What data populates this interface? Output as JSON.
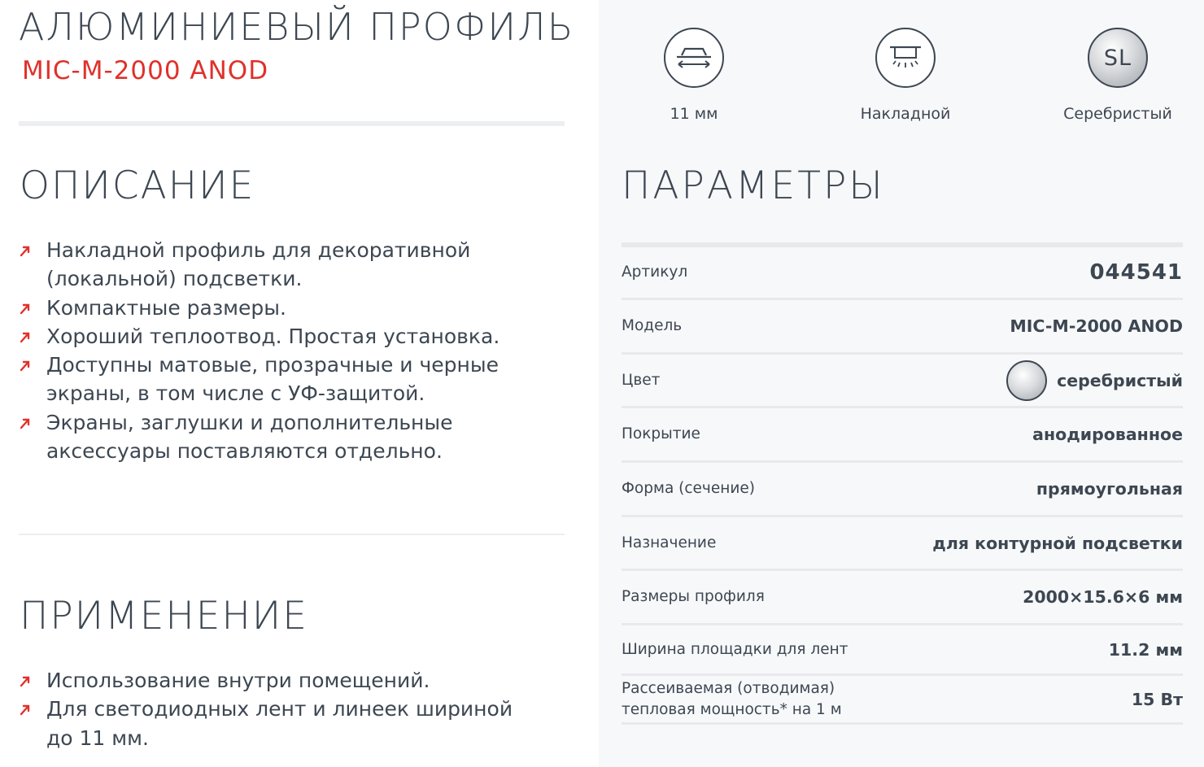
{
  "product": {
    "title": "АЛЮМИНИЕВЫЙ ПРОФИЛЬ",
    "model": "MIC-M-2000 ANOD"
  },
  "description": {
    "heading": "ОПИСАНИЕ",
    "bullets": [
      "Накладной профиль для декоративной (локальной) подсветки.",
      "Компактные размеры.",
      "Хороший теплоотвод. Простая установка.",
      "Доступны матовые, прозрачные и черные экраны, в том числе с УФ-защитой.",
      "Экраны, заглушки и дополнительные аксессуары поставляются отдельно."
    ]
  },
  "application": {
    "heading": "ПРИМЕНЕНИЕ",
    "bullets": [
      "Использование внутри помещений.",
      "Для светодиодных лент и линеек шириной до 11 мм."
    ]
  },
  "features": [
    {
      "icon": "width-profile-icon",
      "label": "11 мм"
    },
    {
      "icon": "surface-mount-icon",
      "label": "Накладной"
    },
    {
      "icon": "silver-color-icon",
      "badge": "SL",
      "label": "Серебристый"
    }
  ],
  "parameters": {
    "heading": "ПАРАМЕТРЫ",
    "rows": [
      {
        "key": "Артикул",
        "value": "044541"
      },
      {
        "key": "Модель",
        "value": "MIC-M-2000 ANOD"
      },
      {
        "key": "Цвет",
        "value": "серебристый"
      },
      {
        "key": "Покрытие",
        "value": "анодированное"
      },
      {
        "key": "Форма (сечение)",
        "value": "прямоугольная"
      },
      {
        "key": "Назначение",
        "value": "для контурной подсветки"
      },
      {
        "key": "Размеры профиля",
        "value": "2000×15.6×6 мм"
      },
      {
        "key": "Ширина площадки для лент",
        "value": "11.2 мм"
      },
      {
        "key": "Рассеиваемая (отводимая)",
        "key_line2": "тепловая мощность* на 1 м",
        "value": "15 Вт"
      }
    ]
  },
  "colors": {
    "accent": "#e0312b",
    "text": "#3d4752",
    "panel": "#f7f8fa",
    "rule": "#e7e9ec"
  }
}
